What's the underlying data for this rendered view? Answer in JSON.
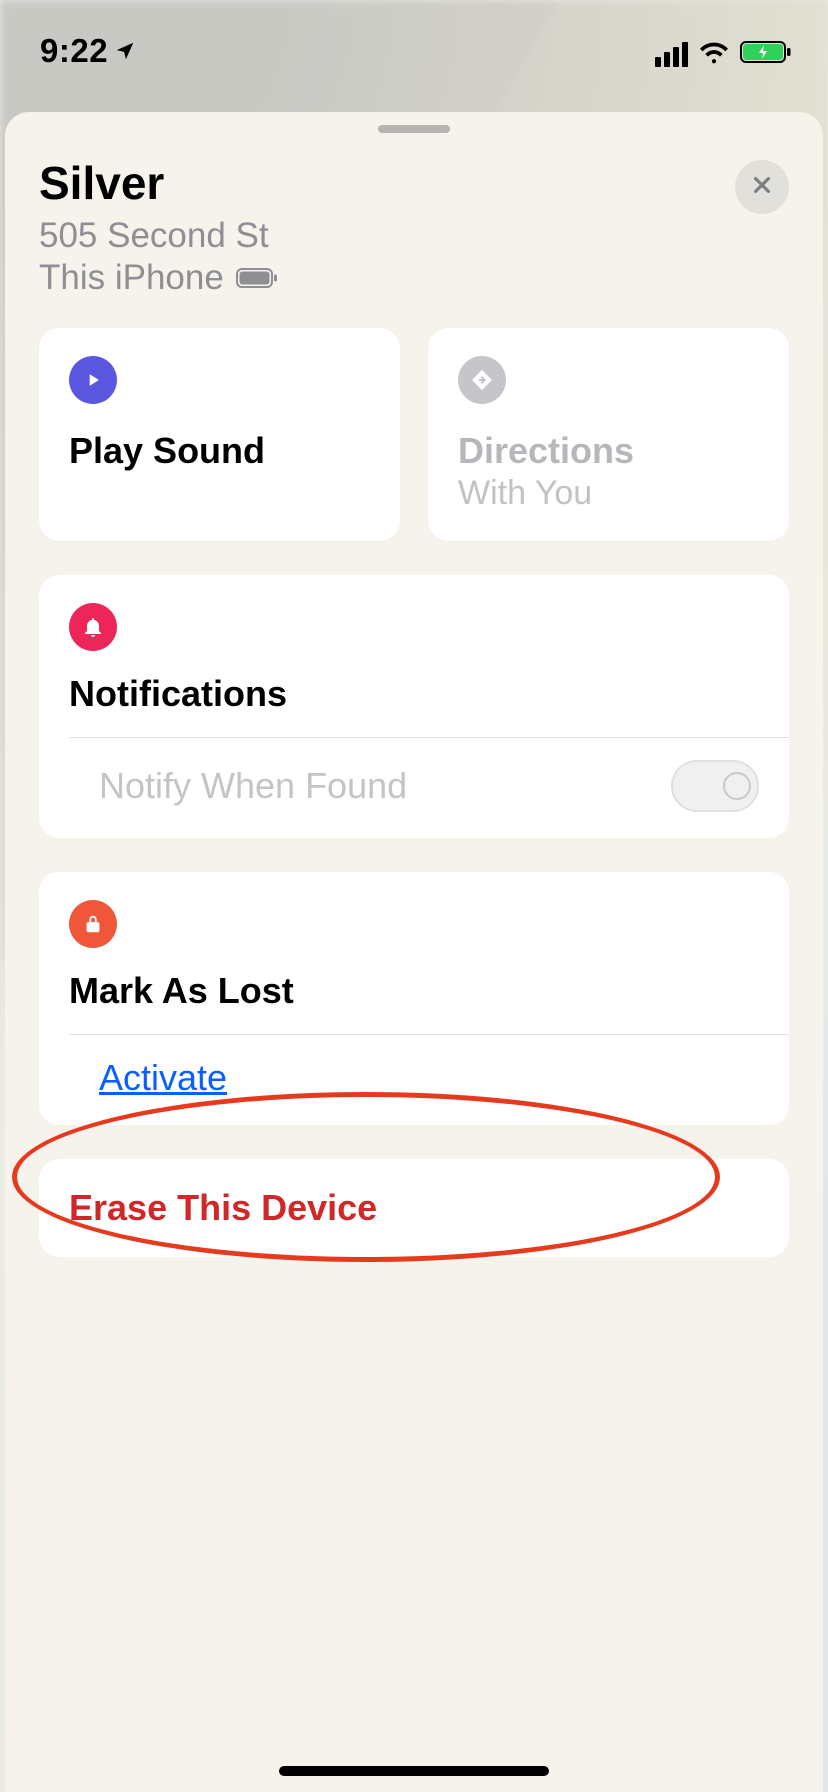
{
  "status": {
    "time": "9:22"
  },
  "device": {
    "name": "Silver",
    "address": "505 Second St",
    "this_label": "This iPhone"
  },
  "actions": {
    "play_sound": "Play Sound",
    "directions": "Directions",
    "directions_sub": "With You"
  },
  "notifications": {
    "title": "Notifications",
    "notify_when_found": "Notify When Found",
    "toggle_on": false
  },
  "mark_lost": {
    "title": "Mark As Lost",
    "activate": "Activate"
  },
  "erase": {
    "label": "Erase This Device"
  }
}
